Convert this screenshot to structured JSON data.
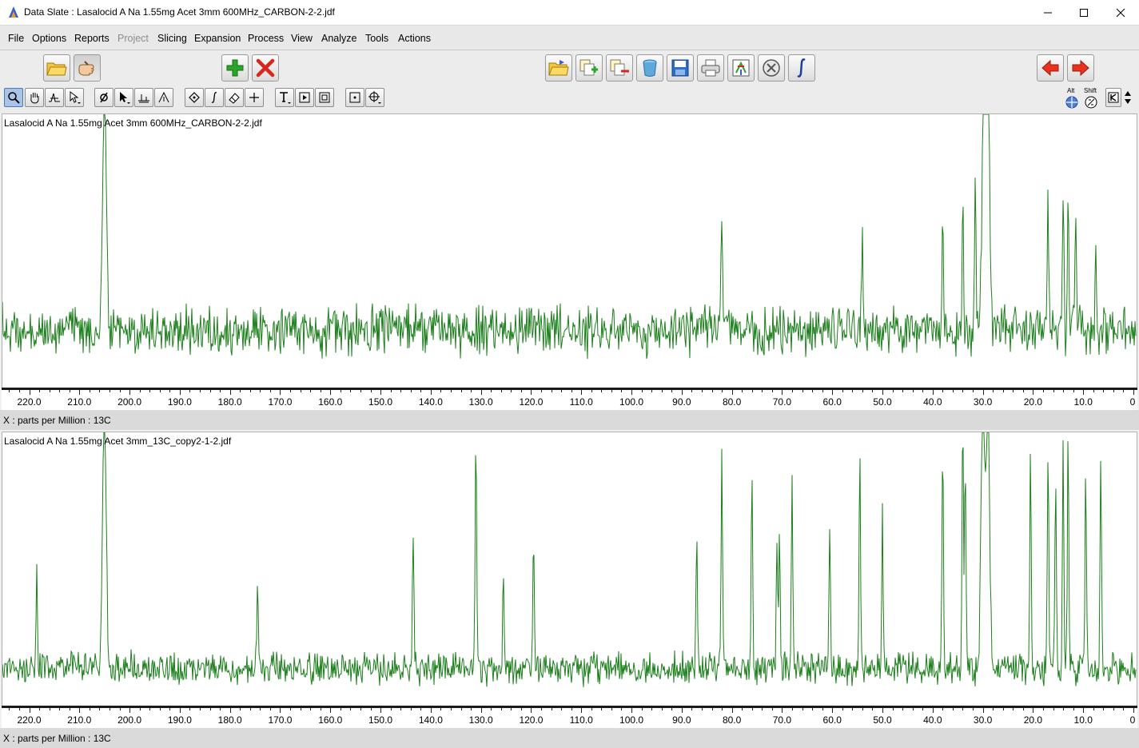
{
  "window": {
    "title": "Data Slate : Lasalocid A Na 1.55mg Acet 3mm 600MHz_CARBON-2-2.jdf",
    "controls": [
      "minimize-icon",
      "maximize-icon",
      "close-icon"
    ]
  },
  "menu": [
    "File",
    "Options",
    "Reports",
    "Project",
    "Slicing",
    "Expansion",
    "Process",
    "View",
    "Analyze",
    "Tools",
    "Actions"
  ],
  "menu_disabled": [
    "Project"
  ],
  "toolbar": {
    "primary_icons": [
      "open-folder-icon",
      "hand-pointer-icon",
      "add-icon",
      "delete-icon",
      "folder-open-icon",
      "copy-add-icon",
      "copy-remove-icon",
      "trash-icon",
      "save-icon",
      "print-icon",
      "molecule-icon",
      "stop-icon",
      "integral-icon",
      "arrow-left-icon",
      "arrow-right-icon"
    ],
    "secondary_icons": [
      "zoom-icon",
      "pan-hand-icon",
      "peak-icon",
      "pointer-icon",
      "phase-icon",
      "cursor-icon",
      "baseline-icon",
      "peak-pick-icon",
      "diamond-icon",
      "integral-small-icon",
      "eraser-icon",
      "crosshair-icon",
      "text-icon",
      "play-box-icon",
      "frame-icon",
      "dot-box-icon",
      "move-icon"
    ],
    "modifiers": {
      "alt": "Alt",
      "shift": "Shift"
    }
  },
  "panels": [
    {
      "title": "Lasalocid A Na 1.55mg Acet 3mm 600MHz_CARBON-2-2.jdf",
      "axis_caption": "X : parts per Million : 13C"
    },
    {
      "title": "Lasalocid A Na 1.55mg Acet 3mm_13C_copy2-1-2.jdf",
      "axis_caption": "X : parts per Million : 13C"
    }
  ],
  "axis": {
    "ticks": [
      "220.0",
      "210.0",
      "200.0",
      "190.0",
      "180.0",
      "170.0",
      "160.0",
      "150.0",
      "140.0",
      "130.0",
      "120.0",
      "110.0",
      "100.0",
      "90.0",
      "80.0",
      "70.0",
      "60.0",
      "50.0",
      "40.0",
      "30.0",
      "20.0",
      "10.0",
      "0"
    ],
    "reversed": true,
    "range": [
      224,
      0
    ],
    "unit": "ppm"
  },
  "colors": {
    "trace": "#1a7f1a",
    "accent_blue": "#3a5fcd",
    "delete_red": "#d8261c",
    "add_green": "#2aa52a"
  },
  "chart_data": [
    {
      "type": "line",
      "title": "Lasalocid A Na 1.55mg Acet 3mm 600MHz_CARBON-2-2.jdf",
      "xlabel": "X : parts per Million : 13C",
      "xlim": [
        224,
        0
      ],
      "series": [
        {
          "peaks_ppm": [
            205.0,
            29.8,
            29.0,
            82.0,
            54.0,
            38.0,
            34.0,
            31.5,
            17.0,
            14.0,
            13.0,
            11.5,
            7.5
          ],
          "peak_heights": [
            1.0,
            1.0,
            1.0,
            0.28,
            0.22,
            0.25,
            0.3,
            0.32,
            0.3,
            0.33,
            0.3,
            0.25,
            0.22
          ]
        }
      ]
    },
    {
      "type": "line",
      "title": "Lasalocid A Na 1.55mg Acet 3mm_13C_copy2-1-2.jdf",
      "xlabel": "X : parts per Million : 13C",
      "xlim": [
        224,
        0
      ],
      "series": [
        {
          "peaks_ppm": [
            218.5,
            205.0,
            174.5,
            143.5,
            131.0,
            125.5,
            119.5,
            87.0,
            82.0,
            76.0,
            71.0,
            70.5,
            68.0,
            60.5,
            54.5,
            50.0,
            38.0,
            34.0,
            33.5,
            30.0,
            29.0,
            20.5,
            17.0,
            15.5,
            14.0,
            13.0,
            9.5,
            6.5
          ],
          "peak_heights": [
            0.22,
            1.0,
            0.2,
            0.3,
            0.5,
            0.22,
            0.3,
            0.3,
            0.45,
            0.42,
            0.3,
            0.3,
            0.4,
            0.3,
            0.45,
            0.34,
            0.5,
            0.53,
            0.47,
            1.0,
            1.0,
            0.47,
            0.47,
            0.45,
            0.52,
            0.5,
            0.45,
            0.45
          ]
        }
      ]
    }
  ]
}
